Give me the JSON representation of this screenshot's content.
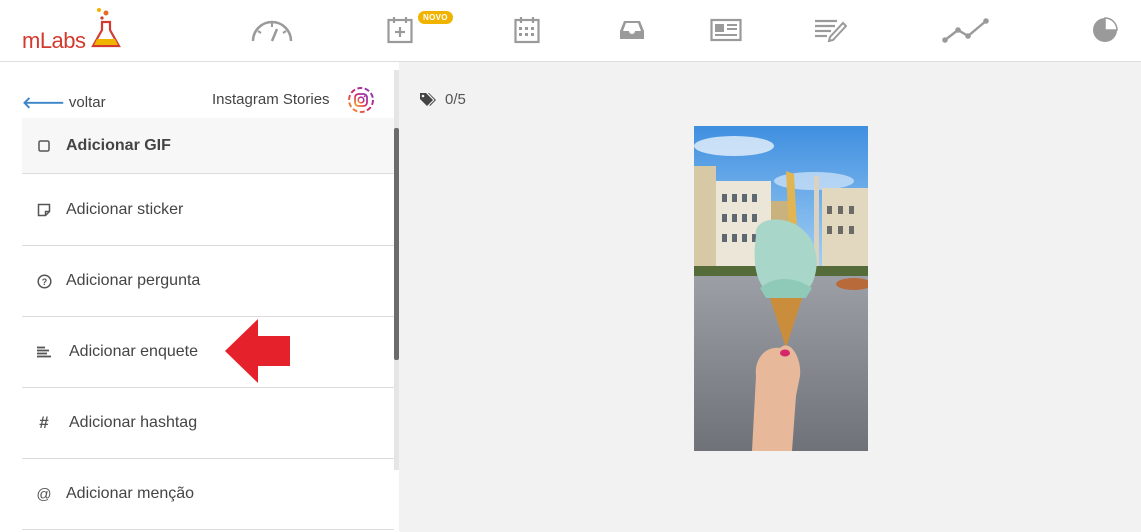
{
  "brand": {
    "logo_text": "mLabs",
    "accent": "#d33a2f"
  },
  "nav": {
    "items": [
      {
        "icon": "gauge-icon"
      },
      {
        "icon": "calendar-add-icon",
        "badge": "NOVO"
      },
      {
        "icon": "calendar-icon"
      },
      {
        "icon": "inbox-icon"
      },
      {
        "icon": "newspaper-icon"
      },
      {
        "icon": "notes-edit-icon"
      },
      {
        "icon": "line-chart-icon"
      },
      {
        "icon": "pie-chart-icon"
      }
    ],
    "badge_color": "#f0b400"
  },
  "panel": {
    "back_label": "voltar",
    "channel_label": "Instagram Stories",
    "items": [
      {
        "label": "Adicionar GIF",
        "icon": "square-icon"
      },
      {
        "label": "Adicionar sticker",
        "icon": "sticker-icon"
      },
      {
        "label": "Adicionar pergunta",
        "icon": "question-circle-icon"
      },
      {
        "label": "Adicionar enquete",
        "icon": "poll-lines-icon"
      },
      {
        "label": "Adicionar hashtag",
        "icon": "hashtag-icon"
      },
      {
        "label": "Adicionar menção",
        "icon": "at-icon"
      }
    ]
  },
  "preview": {
    "tag_count": "0/5",
    "image_desc_icon": "story-photo"
  }
}
